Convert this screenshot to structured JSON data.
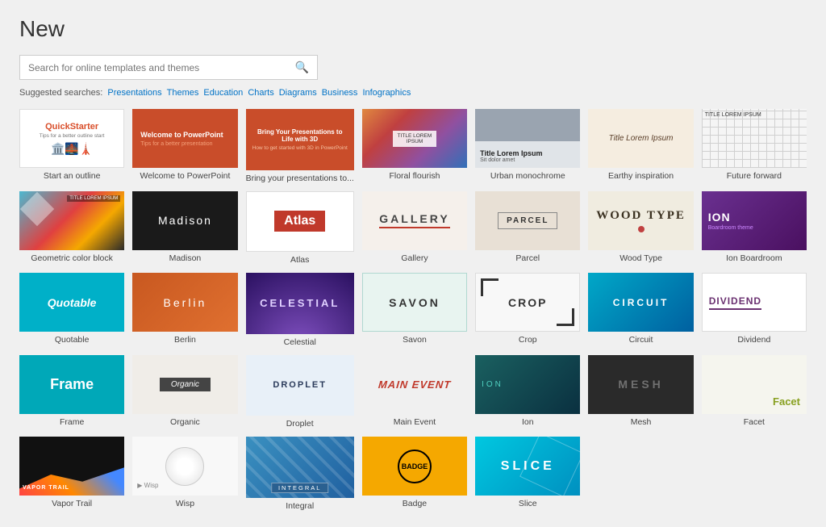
{
  "page": {
    "title": "New",
    "search": {
      "placeholder": "Search for online templates and themes"
    },
    "suggested": {
      "label": "Suggested searches:",
      "links": [
        "Presentations",
        "Themes",
        "Education",
        "Charts",
        "Diagrams",
        "Business",
        "Infographics"
      ]
    }
  },
  "templates": [
    {
      "id": "quickstarter",
      "label": "Start an outline",
      "thumb": "quickstarter"
    },
    {
      "id": "welcome",
      "label": "Welcome to PowerPoint",
      "thumb": "welcome"
    },
    {
      "id": "bring",
      "label": "Bring your presentations to...",
      "thumb": "bring"
    },
    {
      "id": "floral",
      "label": "Floral flourish",
      "thumb": "floral"
    },
    {
      "id": "urban",
      "label": "Urban monochrome",
      "thumb": "urban"
    },
    {
      "id": "earthy",
      "label": "Earthy inspiration",
      "thumb": "earthy"
    },
    {
      "id": "future",
      "label": "Future forward",
      "thumb": "future"
    },
    {
      "id": "geo",
      "label": "Geometric color block",
      "thumb": "geo"
    },
    {
      "id": "madison",
      "label": "Madison",
      "thumb": "madison"
    },
    {
      "id": "atlas",
      "label": "Atlas",
      "thumb": "atlas"
    },
    {
      "id": "gallery",
      "label": "Gallery",
      "thumb": "gallery"
    },
    {
      "id": "parcel",
      "label": "Parcel",
      "thumb": "parcel"
    },
    {
      "id": "woodtype",
      "label": "Wood Type",
      "thumb": "woodtype"
    },
    {
      "id": "ionboardroom",
      "label": "Ion Boardroom",
      "thumb": "ionboardroom"
    },
    {
      "id": "quotable",
      "label": "Quotable",
      "thumb": "quotable"
    },
    {
      "id": "berlin",
      "label": "Berlin",
      "thumb": "berlin"
    },
    {
      "id": "celestial",
      "label": "Celestial",
      "thumb": "celestial"
    },
    {
      "id": "savon",
      "label": "Savon",
      "thumb": "savon"
    },
    {
      "id": "crop",
      "label": "Crop",
      "thumb": "crop"
    },
    {
      "id": "circuit",
      "label": "Circuit",
      "thumb": "circuit"
    },
    {
      "id": "dividend",
      "label": "Dividend",
      "thumb": "dividend"
    },
    {
      "id": "frame",
      "label": "Frame",
      "thumb": "frame"
    },
    {
      "id": "organic",
      "label": "Organic",
      "thumb": "organic"
    },
    {
      "id": "droplet",
      "label": "Droplet",
      "thumb": "droplet"
    },
    {
      "id": "mainevent",
      "label": "Main Event",
      "thumb": "mainevent"
    },
    {
      "id": "ion",
      "label": "Ion",
      "thumb": "ion"
    },
    {
      "id": "mesh",
      "label": "Mesh",
      "thumb": "mesh"
    },
    {
      "id": "facet",
      "label": "Facet",
      "thumb": "facet"
    },
    {
      "id": "vaportrail",
      "label": "Vapor Trail",
      "thumb": "vaportrail"
    },
    {
      "id": "wisp",
      "label": "Wisp",
      "thumb": "wisp"
    },
    {
      "id": "integral",
      "label": "Integral",
      "thumb": "integral"
    },
    {
      "id": "badge",
      "label": "Badge",
      "thumb": "badge"
    },
    {
      "id": "slice",
      "label": "Slice",
      "thumb": "slice"
    }
  ]
}
